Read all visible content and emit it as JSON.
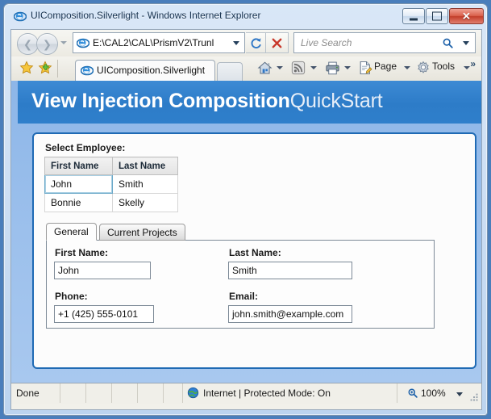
{
  "window": {
    "title": "UIComposition.Silverlight - Windows Internet Explorer",
    "icon": "ie-logo-icon",
    "controls": {
      "minimize": "minimize-button",
      "maximize": "maximize-restore-button",
      "close_glyph": "✕"
    }
  },
  "navigation": {
    "back": "back-button",
    "forward": "forward-button",
    "recent_pages": "recent-pages-dropdown",
    "address": {
      "value": "E:\\CAL2\\CAL\\PrismV2\\Trunl",
      "icon": "ie-logo-icon"
    },
    "refresh": "refresh-button",
    "stop": "stop-button",
    "search": {
      "placeholder": "Live Search",
      "go_icon": "🔍"
    }
  },
  "tabbar": {
    "favorites_center": "favorites-star-icon",
    "add_favorites": "add-to-favorites-icon",
    "tab_label": "UIComposition.Silverlight",
    "new_tab": "new-tab-button",
    "commands": [
      {
        "label": "",
        "icon": "home-icon",
        "has_dropdown": true
      },
      {
        "label": "",
        "icon": "rss-feed-icon",
        "has_dropdown": true
      },
      {
        "label": "",
        "icon": "print-icon",
        "has_dropdown": true
      },
      {
        "label": "Page",
        "icon": "page-icon",
        "has_dropdown": true
      },
      {
        "label": "Tools",
        "icon": "tools-gear-icon",
        "has_dropdown": true
      }
    ],
    "overflow": "»"
  },
  "page": {
    "title_bold": "View Injection Composition",
    "title_normal": "QuickStart",
    "employee_grid": {
      "label": "Select Employee:",
      "columns": [
        "First Name",
        "Last Name"
      ],
      "rows": [
        {
          "first": "John",
          "last": "Smith",
          "selected": true
        },
        {
          "first": "Bonnie",
          "last": "Skelly",
          "selected": false
        }
      ]
    },
    "tabs": [
      {
        "label": "General",
        "active": true
      },
      {
        "label": "Current Projects",
        "active": false
      }
    ],
    "form": {
      "first_name": {
        "label": "First Name:",
        "value": "John"
      },
      "last_name": {
        "label": "Last Name:",
        "value": "Smith"
      },
      "phone": {
        "label": "Phone:",
        "value": "+1 (425) 555-0101"
      },
      "email": {
        "label": "Email:",
        "value": "john.smith@example.com"
      }
    }
  },
  "statusbar": {
    "status": "Done",
    "zone": "Internet | Protected Mode: On",
    "zone_icon": "internet-globe-icon",
    "zoom": "100%"
  },
  "colors": {
    "header_blue": "#2d7cc8",
    "panel_border": "#1f6ab4",
    "page_background": "#9cc0ec",
    "close_red": "#c23d29"
  }
}
